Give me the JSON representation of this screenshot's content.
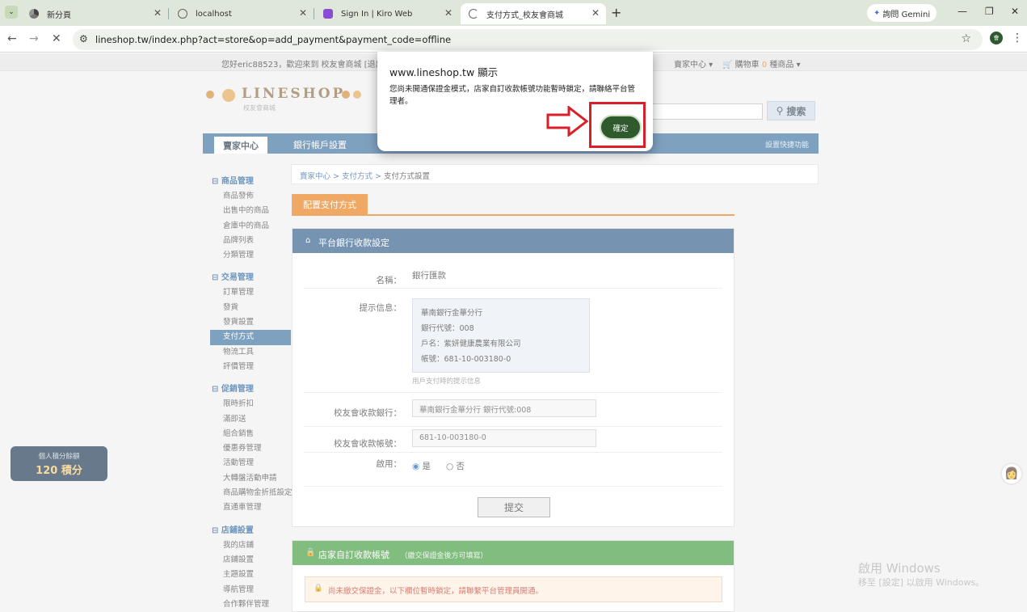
{
  "browser": {
    "tabs": [
      {
        "title": "新分頁",
        "icon": "chrome-icon"
      },
      {
        "title": "localhost",
        "icon": "globe-icon"
      },
      {
        "title": "Sign In | Kiro Web",
        "icon": "kiro-icon"
      },
      {
        "title": "支付方式_校友會商城",
        "icon": "loading-icon",
        "active": true
      }
    ],
    "gemini_label": "詢問 Gemini",
    "url": "lineshop.tw/index.php?act=store&op=add_payment&payment_code=offline",
    "profile_initial": "會"
  },
  "topbar": {
    "greeting": "您好eric88523，歡迎來到 校友會商城 [退出]",
    "seller_center": "賣家中心",
    "cart": "購物車",
    "cart_count": "0",
    "cart_suffix": "種商品"
  },
  "logo": {
    "word": "LINESHOP",
    "sub": "校友會商城"
  },
  "search": {
    "button": "搜索"
  },
  "mainnav": {
    "center": "賣家中心",
    "bank": "銀行帳戶設置",
    "right": "設置快捷功能"
  },
  "sidebar": {
    "groups": [
      {
        "title": "商品管理",
        "items": [
          "商品發佈",
          "出售中的商品",
          "倉庫中的商品",
          "品牌列表",
          "分類管理"
        ]
      },
      {
        "title": "交易管理",
        "items": [
          "訂單管理",
          "發貨",
          "發貨設置",
          "支付方式",
          "物流工具",
          "評價管理"
        ]
      },
      {
        "title": "促銷管理",
        "items": [
          "限時折扣",
          "滿即送",
          "組合銷售",
          "優惠券管理",
          "活動管理",
          "大轉盤活動申請",
          "商品購物金折抵設定",
          "直通車管理"
        ]
      },
      {
        "title": "店鋪設置",
        "items": [
          "我的店鋪",
          "店鋪設置",
          "主題設置",
          "導航管理",
          "合作夥伴管理"
        ]
      }
    ]
  },
  "breadcrumb": {
    "a": "賣家中心",
    "b": "支付方式",
    "c": "支付方式設置"
  },
  "subtab": "配置支付方式",
  "panel": {
    "title": "平台銀行收款設定",
    "name_label": "名稱：",
    "name_value": "銀行匯款",
    "hint_label": "提示信息：",
    "hint_lines": [
      "華南銀行金華分行",
      "銀行代號：008",
      "戶名：紫妍健康農業有限公司",
      "帳號：681-10-003180-0"
    ],
    "hint_note": "用戶支付時的提示信息",
    "bank_label": "校友會收款銀行：",
    "bank_value": "華南銀行金華分行 銀行代號:008",
    "account_label": "校友會收款帳號：",
    "account_value": "681-10-003180-0",
    "enable_label": "啟用：",
    "yes": "是",
    "no": "否",
    "submit": "提交"
  },
  "panel2": {
    "title": "店家自訂收款帳號",
    "subtitle": "（繳交保證金後方可填寫）",
    "warning": "尚未繳交保證金，以下欄位暫時鎖定，請聯繫平台管理員開通。"
  },
  "points": {
    "l1": "個人積分餘額",
    "l2": "120 積分"
  },
  "watermark": {
    "l1": "啟用 Windows",
    "l2": "移至 [設定] 以啟用 Windows。"
  },
  "dialog": {
    "title": "www.lineshop.tw 顯示",
    "message": "您尚未開通保證金模式，店家自訂收款帳號功能暫時鎖定，請聯絡平台管理者。",
    "ok": "確定"
  },
  "colors": {
    "nav_blue": "#3b6f9e",
    "accent_orange": "#e87c12",
    "ok_green": "#2e5a2e",
    "highlight_red": "#d9202a"
  }
}
